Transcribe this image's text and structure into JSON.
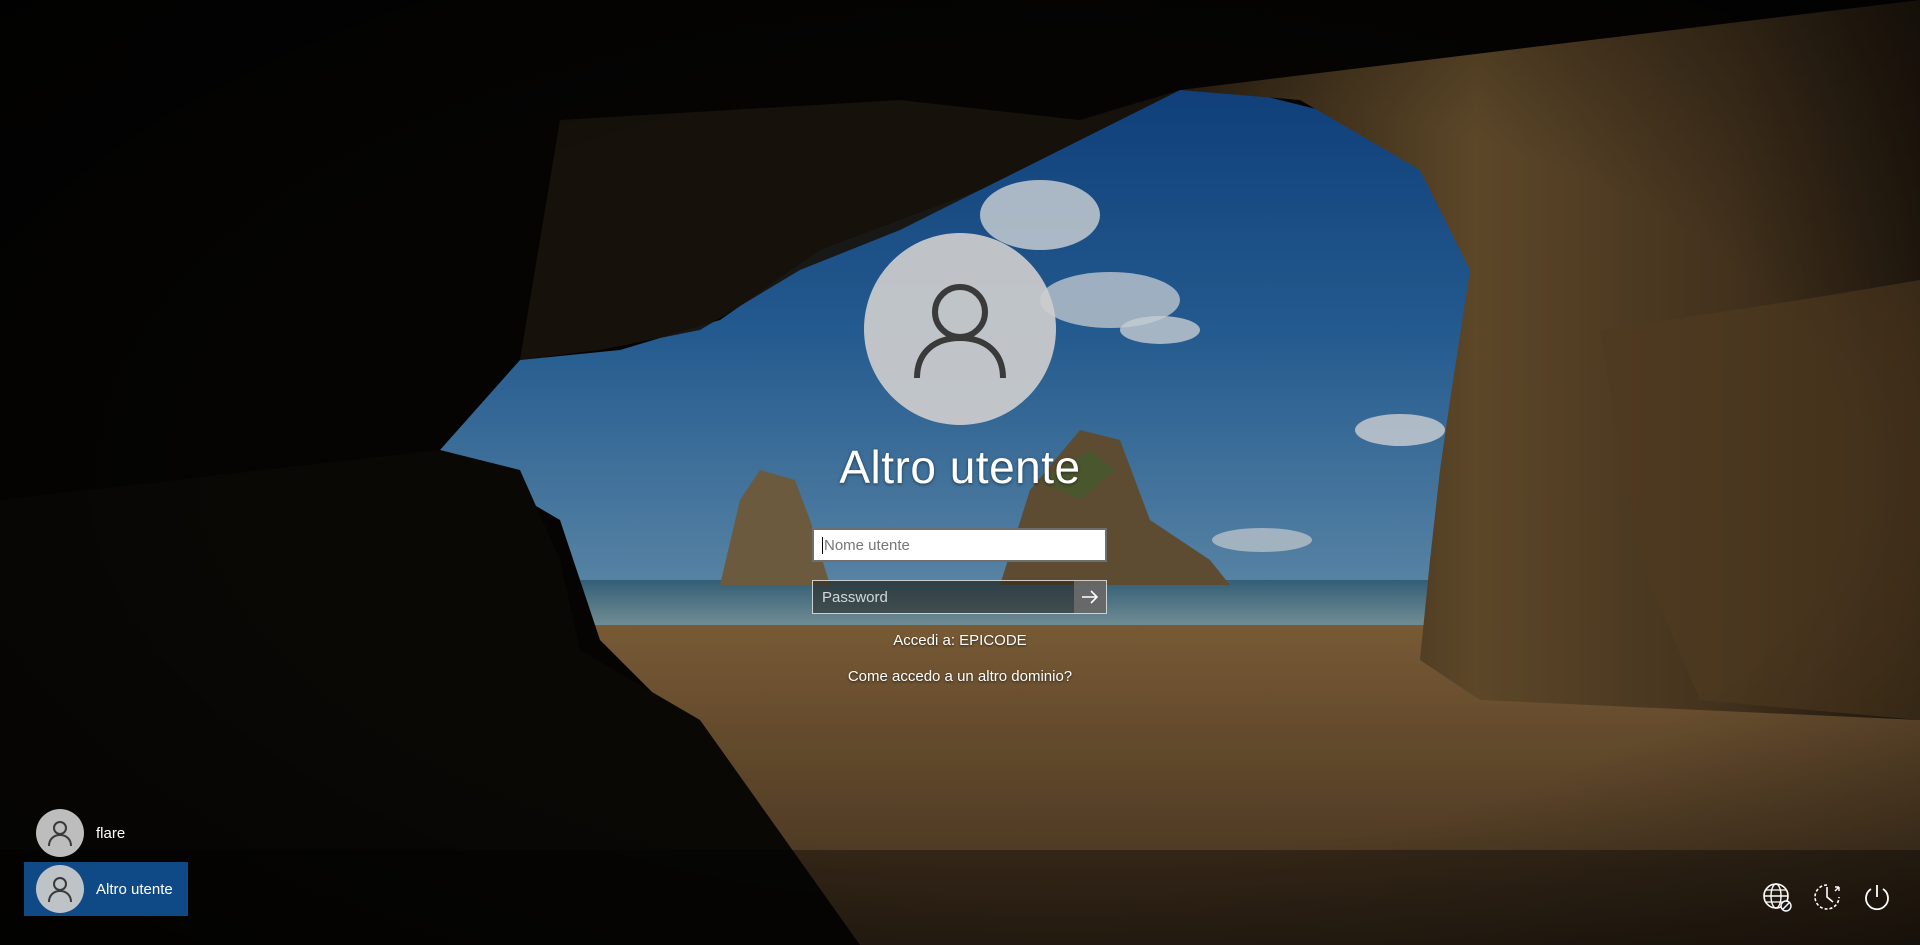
{
  "login": {
    "user_title": "Altro utente",
    "username_placeholder": "Nome utente",
    "password_placeholder": "Password",
    "domain_text": "Accedi a: EPICODE",
    "other_domain_link": "Come accedo a un altro dominio?"
  },
  "user_list": [
    {
      "name": "flare",
      "selected": false
    },
    {
      "name": "Altro utente",
      "selected": true
    }
  ],
  "system_icons": [
    "network-icon",
    "accessibility-icon",
    "power-icon"
  ],
  "colors": {
    "selected_user_bg": "#0f4a86",
    "text": "#ffffff",
    "avatar_bg": "#cdcdcd"
  }
}
